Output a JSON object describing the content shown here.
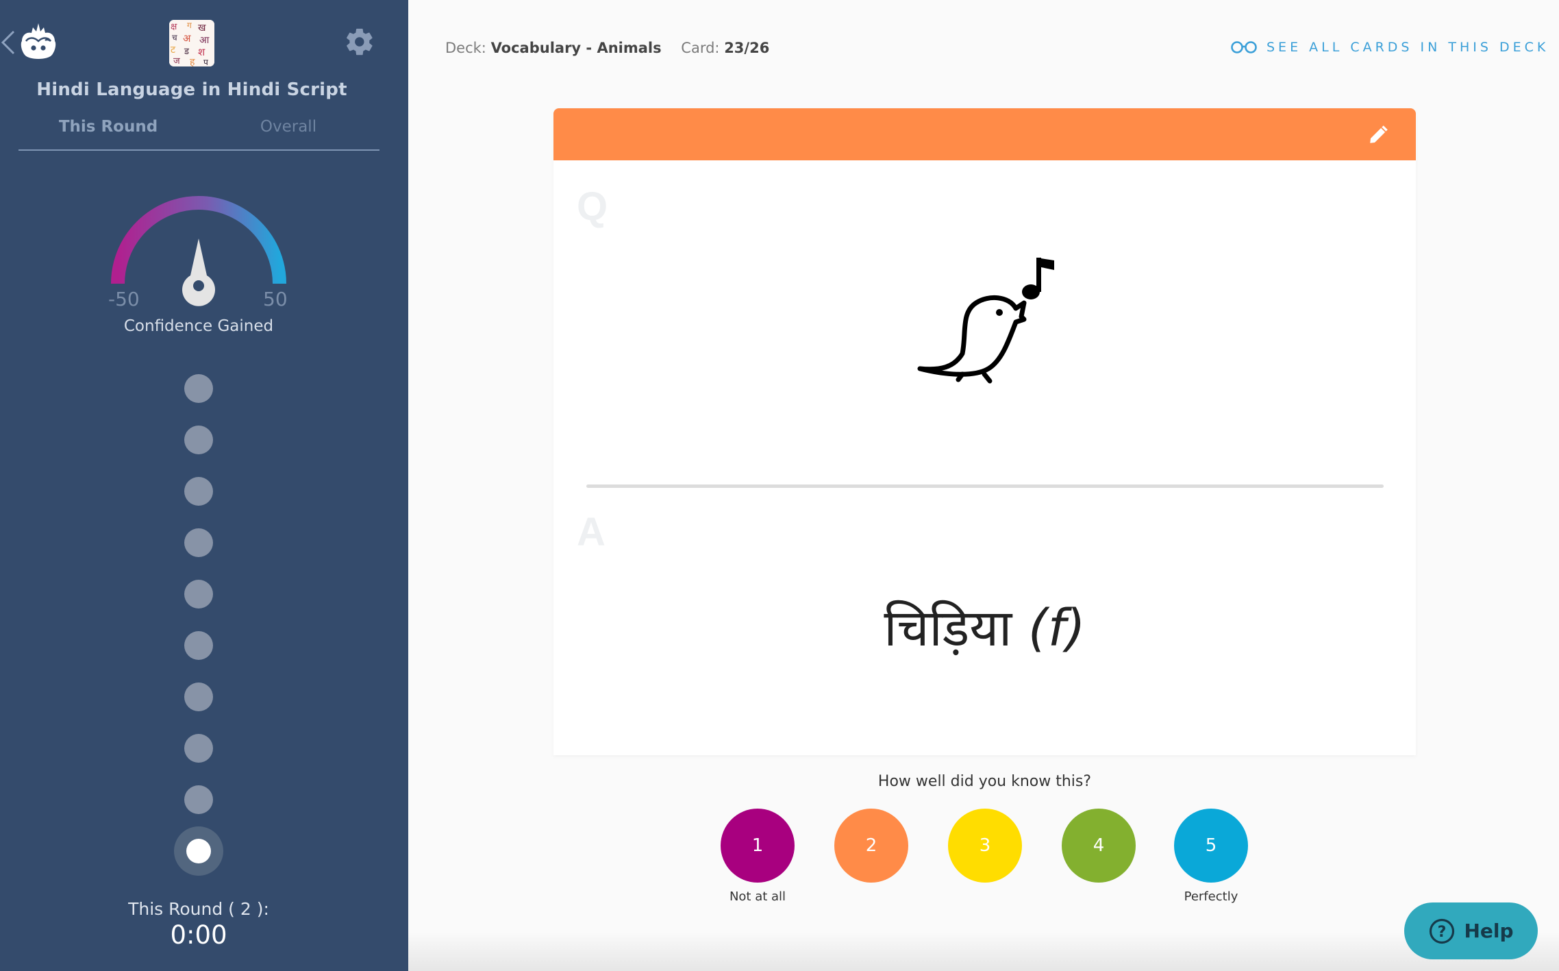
{
  "sidebar": {
    "deck_title": "Hindi Language in Hindi Script",
    "tabs": [
      {
        "label": "This Round",
        "active": true
      },
      {
        "label": "Overall",
        "active": false
      }
    ],
    "gauge": {
      "min_label": "-50",
      "max_label": "50",
      "caption": "Confidence Gained",
      "value": 0,
      "min": -50,
      "max": 50
    },
    "progress_dots": {
      "total": 10,
      "active_index": 9
    },
    "round_label": "This Round ( 2 ):",
    "round_time": "0:00"
  },
  "header": {
    "deck_prefix": "Deck:",
    "deck_name": "Vocabulary - Animals",
    "card_prefix": "Card:",
    "card_position": "23/26",
    "see_all_label": "SEE ALL CARDS IN THIS DECK"
  },
  "card": {
    "header_color": "#ff8b48",
    "question_letter": "Q",
    "answer_letter": "A",
    "question_image": "singing-bird-icon",
    "answer_text": "चिड़िया",
    "answer_gender": "(f)"
  },
  "rating": {
    "prompt": "How well did you know this?",
    "buttons": [
      {
        "label": "1",
        "color": "#a8007f",
        "caption": "Not at all"
      },
      {
        "label": "2",
        "color": "#ff8b48",
        "caption": ""
      },
      {
        "label": "3",
        "color": "#ffdd00",
        "caption": ""
      },
      {
        "label": "4",
        "color": "#83b02f",
        "caption": ""
      },
      {
        "label": "5",
        "color": "#0aa8d8",
        "caption": "Perfectly"
      }
    ]
  },
  "help": {
    "label": "Help"
  }
}
